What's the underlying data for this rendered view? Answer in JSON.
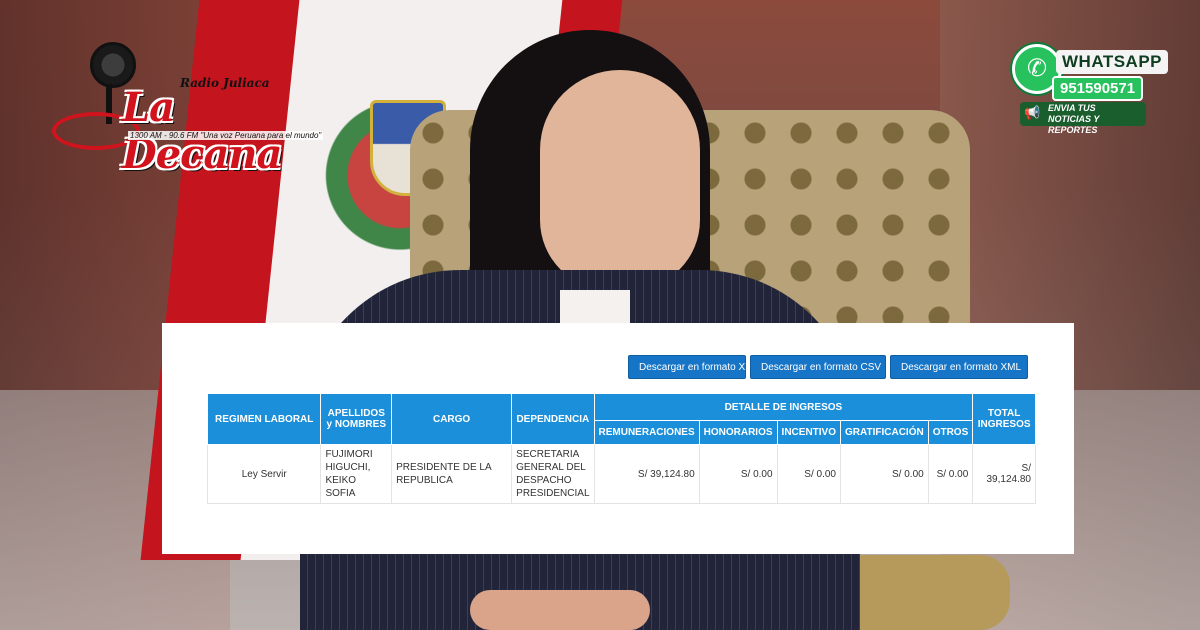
{
  "logo": {
    "top": "Radio Juliaca",
    "name": "La Decana",
    "tagline": "1300 AM - 90.6 FM \"Una voz Peruana para el mundo\""
  },
  "whatsapp": {
    "title": "WHATSAPP",
    "number": "951590571",
    "note_line1": "ENVIA TUS",
    "note_line2": "NOTICIAS Y REPORTES"
  },
  "toolbar": {
    "xls_label": "Descargar en formato XLS",
    "csv_label": "Descargar en formato CSV",
    "xml_label": "Descargar en formato XML"
  },
  "table": {
    "headers": {
      "regimen": "REGIMEN LABORAL",
      "apellidos": "APELLIDOS y NOMBRES",
      "cargo": "CARGO",
      "dependencia": "DEPENDENCIA",
      "detalle": "DETALLE DE INGRESOS",
      "remuneraciones": "REMUNERACIONES",
      "honorarios": "HONORARIOS",
      "incentivo": "INCENTIVO",
      "gratificacion": "GRATIFICACIÓN",
      "otros": "OTROS",
      "total": "TOTAL INGRESOS"
    },
    "rows": [
      {
        "regimen": "Ley Servir",
        "apellidos": "FUJIMORI HIGUCHI, KEIKO SOFIA",
        "cargo": "PRESIDENTE DE LA REPUBLICA",
        "dependencia": "SECRETARIA GENERAL DEL DESPACHO PRESIDENCIAL",
        "remuneraciones": "S/ 39,124.80",
        "honorarios": "S/ 0.00",
        "incentivo": "S/ 0.00",
        "gratificacion": "S/ 0.00",
        "otros": "S/ 0.00",
        "total": "S/ 39,124.80"
      }
    ]
  }
}
